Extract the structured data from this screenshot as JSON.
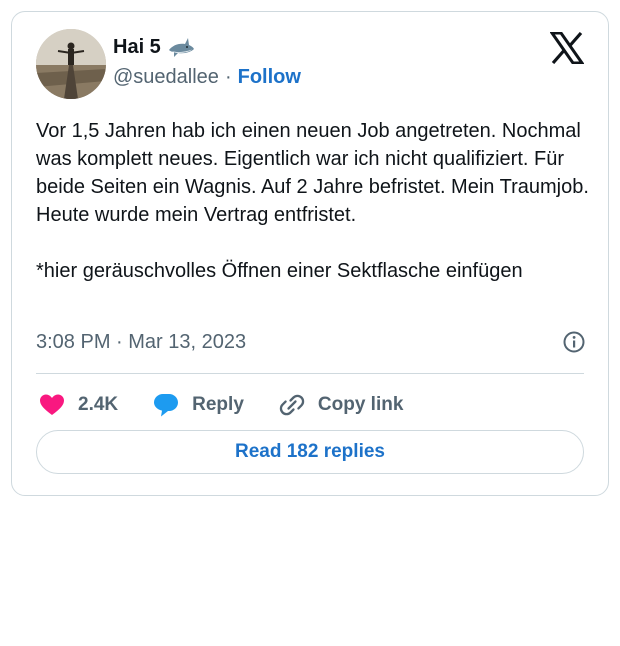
{
  "tweet": {
    "author_name": "Hai 5",
    "handle": "@suedallee",
    "separator": "·",
    "follow_label": "Follow",
    "text": "Vor 1,5 Jahren hab ich einen neuen Job angetreten. Nochmal was komplett neues. Eigentlich war ich nicht qualifiziert. Für beide Seiten ein Wagnis. Auf 2 Jahre befristet. Mein Traumjob. Heute wurde mein Vertrag entfristet.\n\n*hier geräuschvolles Öffnen einer Sektflasche einfügen",
    "timestamp": "3:08 PM · Mar 13, 2023",
    "like_count": "2.4K",
    "reply_label": "Reply",
    "copy_link_label": "Copy link",
    "read_replies_label": "Read 182 replies"
  },
  "icons": {
    "name_emoji": "shark-icon",
    "brand": "x-logo-icon",
    "info": "info-icon",
    "like": "heart-icon",
    "reply": "speech-bubble-icon",
    "copy": "link-icon"
  },
  "colors": {
    "heart": "#f91880",
    "reply_bubble": "#1d9bf0",
    "link_blue": "#1d72c9",
    "secondary_text": "#536471",
    "border": "#cfd9de"
  }
}
